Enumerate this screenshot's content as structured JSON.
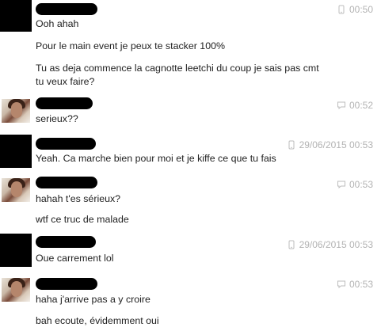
{
  "messages": [
    {
      "time": "00:50",
      "device": "phone-icon",
      "lines": [
        "Ooh ahah",
        "Pour le main event je peux te stacker 100%",
        "Tu as deja commence la cagnotte leetchi du coup je sais pas cmt tu veux faire?"
      ]
    },
    {
      "time": "00:52",
      "device": "chat-icon",
      "lines": [
        "serieux??"
      ]
    },
    {
      "time": "29/06/2015 00:53",
      "device": "phone-icon",
      "lines": [
        "Yeah. Ca marche bien pour moi et je kiffe ce que tu fais"
      ]
    },
    {
      "time": "00:53",
      "device": "chat-icon",
      "lines": [
        "hahah t'es sérieux?",
        "wtf ce truc de malade"
      ]
    },
    {
      "time": "29/06/2015 00:53",
      "device": "phone-icon",
      "lines": [
        "Oue carrement lol"
      ]
    },
    {
      "time": "00:53",
      "device": "chat-icon",
      "lines": [
        "haha j'arrive pas a y croire",
        "bah ecoute, évidemment oui"
      ]
    }
  ]
}
